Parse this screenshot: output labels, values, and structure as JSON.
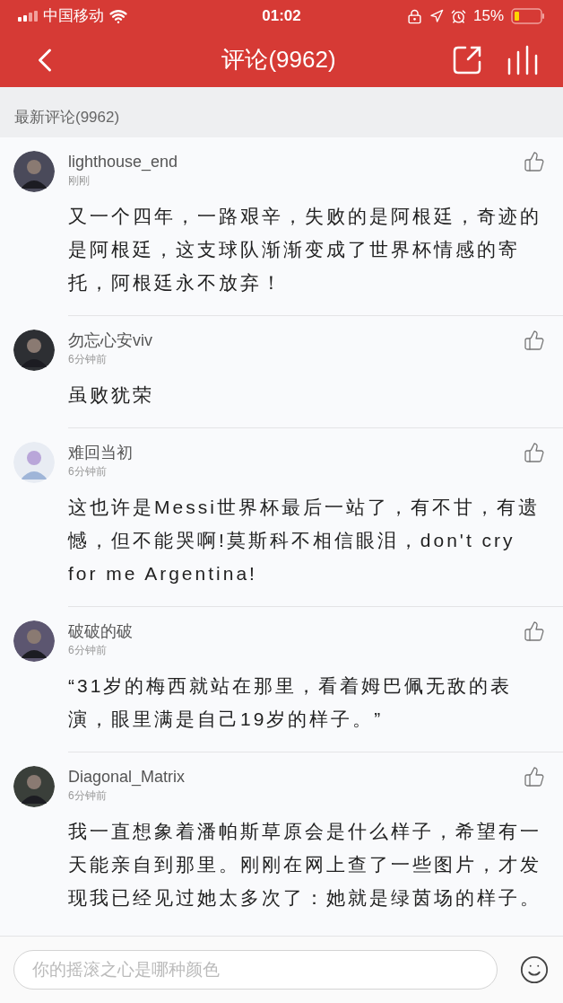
{
  "status_bar": {
    "carrier": "中国移动",
    "time": "01:02",
    "battery": "15%"
  },
  "nav": {
    "title": "评论(9962)"
  },
  "section": {
    "title": "最新评论(9962)"
  },
  "comments": [
    {
      "name": "lighthouse_end",
      "time": "刚刚",
      "text": "又一个四年，一路艰辛，失败的是阿根廷，奇迹的是阿根廷，这支球队渐渐变成了世界杯情感的寄托，阿根廷永不放弃！"
    },
    {
      "name": "勿忘心安viv",
      "time": "6分钟前",
      "text": "虽败犹荣"
    },
    {
      "name": "难回当初",
      "time": "6分钟前",
      "text": "这也许是Messi世界杯最后一站了，有不甘，有遗憾，但不能哭啊!莫斯科不相信眼泪，don't cry for me Argentina!"
    },
    {
      "name": "破破的破",
      "time": "6分钟前",
      "text": "“31岁的梅西就站在那里，看着姆巴佩无敌的表演，眼里满是自己19岁的样子。”"
    },
    {
      "name": "Diagonal_Matrix",
      "time": "6分钟前",
      "text": "我一直想象着潘帕斯草原会是什么样子，希望有一天能亲自到那里。刚刚在网上查了一些图片，才发现我已经见过她太多次了：她就是绿茵场的样子。"
    }
  ],
  "input": {
    "placeholder": "你的摇滚之心是哪种颜色"
  }
}
